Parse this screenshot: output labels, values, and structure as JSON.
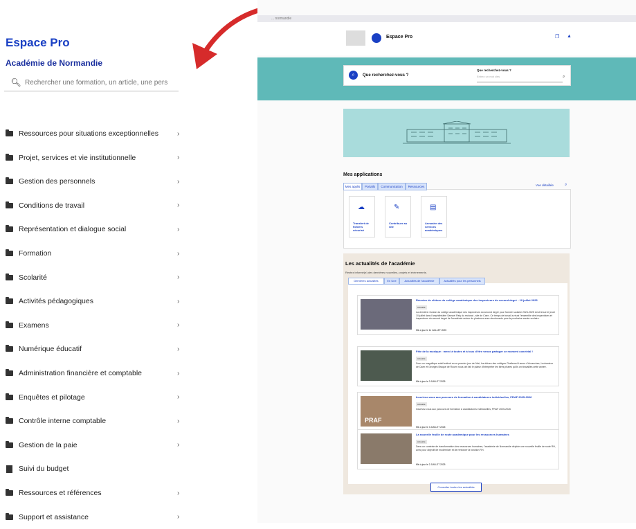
{
  "sidebar": {
    "title": "Espace Pro",
    "subtitle": "Académie de Normandie",
    "search_placeholder": "Rechercher une formation, un article, une pers",
    "items": [
      {
        "label": "Ressources pour situations exceptionnelles",
        "icon": "folder-icon",
        "chevron": "›"
      },
      {
        "label": "Projet, services et vie institutionnelle",
        "icon": "folder-icon",
        "chevron": "›"
      },
      {
        "label": "Gestion des personnels",
        "icon": "folder-icon",
        "chevron": "›"
      },
      {
        "label": "Conditions de travail",
        "icon": "folder-icon",
        "chevron": "›"
      },
      {
        "label": "Représentation et dialogue social",
        "icon": "folder-icon",
        "chevron": "›"
      },
      {
        "label": "Formation",
        "icon": "folder-icon",
        "chevron": "›"
      },
      {
        "label": "Scolarité",
        "icon": "folder-icon",
        "chevron": "›"
      },
      {
        "label": "Activités pédagogiques",
        "icon": "folder-icon",
        "chevron": "›"
      },
      {
        "label": "Examens",
        "icon": "folder-icon",
        "chevron": "›"
      },
      {
        "label": "Numérique éducatif",
        "icon": "folder-icon",
        "chevron": "›"
      },
      {
        "label": "Administration financière et comptable",
        "icon": "folder-icon",
        "chevron": "›"
      },
      {
        "label": "Enquêtes et pilotage",
        "icon": "folder-icon",
        "chevron": "›"
      },
      {
        "label": "Contrôle interne comptable",
        "icon": "folder-icon",
        "chevron": "›"
      },
      {
        "label": "Gestion de la paie",
        "icon": "folder-icon",
        "chevron": "›"
      },
      {
        "label": "Suivi du budget",
        "icon": "document-icon",
        "chevron": ""
      },
      {
        "label": "Ressources et références",
        "icon": "folder-icon",
        "chevron": "›"
      },
      {
        "label": "Support et assistance",
        "icon": "folder-icon",
        "chevron": "›"
      }
    ]
  },
  "preview": {
    "breadcrumb": "... normandie",
    "site_name": "Espace Pro",
    "search": {
      "prompt": "Que recherchez-vous ?",
      "label": "Que recherchez-vous ?",
      "placeholder": "Entrez un mot clés"
    },
    "apps": {
      "title": "Mes applications",
      "tabs": [
        "Mes applis",
        "Portails",
        "Communication",
        "Ressources"
      ],
      "detail_link": "Vue détaillée",
      "items": [
        {
          "label": "Transfert de fichiers sécurisé",
          "icon": "cloud-upload-icon"
        },
        {
          "label": "Contribuer au site",
          "icon": "pen-icon"
        },
        {
          "label": "Annuaire des services académiques",
          "icon": "book-icon"
        }
      ]
    },
    "news": {
      "title": "Les actualités de l'académie",
      "subtitle": "Restez informé(e) des dernières nouvelles, projets et événements.",
      "tabs": [
        "Dernières actualités",
        "En Une",
        "Actualités de l'académie",
        "Actualités pour les personnels"
      ],
      "cards": [
        {
          "title": "Réunion de clôture du collège académique des inspecteurs du second degré - 10 juillet 2025",
          "badge": "Actualité",
          "text": "La dernière réunion du collège académique des inspecteurs du second degré pour l'année scolaire 2024-2025 s'est tenue le jeudi 10 juillet dans l'amphithéâtre Samuel Paty du rectorat - site de Caen. Ce temps de travail a réuni l'ensemble des inspectrices et inspecteurs du second degré de l'académie autour de plusieurs axes structurants pour la prochaine année scolaire.",
          "date": "Mis à jour le 11 JUILLET 2025"
        },
        {
          "title": "Fête de la musique : merci à toutes et à tous d'être venus partager ce moment convivial !",
          "badge": "Actualité",
          "text": "Sous un magnifique soleil estival en ce premier jour de l'été, les élèves des collèges Challemel-Lacour d'Avranches, Lechanteur de Caen et Georges Braque de Rouen nous ont fait le plaisir d'interpréter les titres phares qu'ils ont travaillés cette année.",
          "date": "Mis à jour le 3 JUILLET 2025"
        },
        {
          "title": "Inscrivez-vous aux parcours de formation à candidatures individuelles, PRAF 2025-2026",
          "badge": "Actualité",
          "text": "Inscrivez-vous aux parcours de formation à candidatures individuelles, PRAF 2025-2026",
          "date": "Mis à jour le 3 JUILLET 2025",
          "image_text": "PRAF"
        },
        {
          "title": "La nouvelle feuille de route académique pour les ressources humaines",
          "badge": "Actualité",
          "text": "Dans un contexte de transformation des ressources humaines, l'académie de Normandie déploie une nouvelle feuille de route RH, avec pour objectif de moderniser et de renforcer la fonction RH.",
          "date": "Mis à jour le 2 JUILLET 2025"
        }
      ],
      "all_button": "Consulter toutes les actualités"
    }
  },
  "colors": {
    "accent": "#1a40c4",
    "teal": "#5fb9b8",
    "arrow": "#d62b2b"
  }
}
